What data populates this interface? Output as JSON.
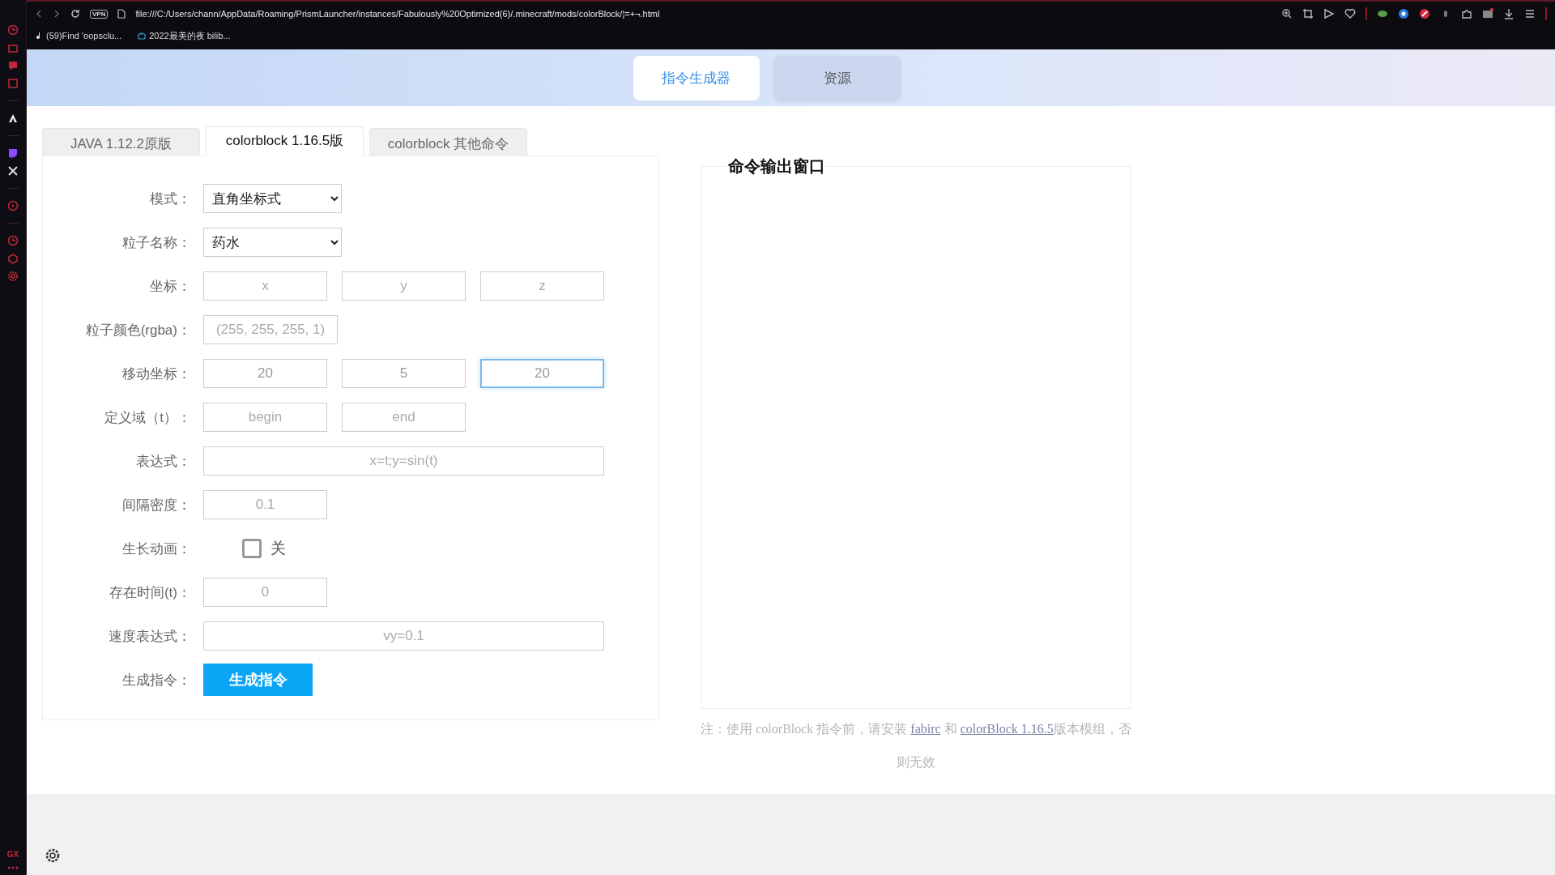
{
  "browser": {
    "url": "file:///C:/Users/chann/AppData/Roaming/PrismLauncher/instances/Fabulously%20Optimized(6)/.minecraft/mods/colorBlock/¦=+¬.html",
    "vpn_badge": "VPN",
    "bookmarks": [
      {
        "label": "(59)Find 'oopsclu..."
      },
      {
        "label": "2022最美的夜 bilib..."
      }
    ]
  },
  "sidebar": {
    "label": "GX"
  },
  "nav": [
    {
      "label": "指令生成器",
      "selected": true
    },
    {
      "label": "资源",
      "selected": false
    }
  ],
  "tabs": [
    {
      "label": "JAVA 1.12.2原版",
      "selected": false
    },
    {
      "label": "colorblock 1.16.5版",
      "selected": true
    },
    {
      "label": "colorblock 其他命令",
      "selected": false
    }
  ],
  "form": {
    "rows": [
      {
        "kind": "select",
        "label": "模式：",
        "value": "直角坐标式"
      },
      {
        "kind": "select",
        "label": "粒子名称：",
        "value": "药水"
      },
      {
        "kind": "inputs",
        "label": "坐标：",
        "fields": [
          {
            "placeholder": "x",
            "focused": false
          },
          {
            "placeholder": "y",
            "focused": false
          },
          {
            "placeholder": "z",
            "focused": false
          }
        ]
      },
      {
        "kind": "color",
        "label": "粒子颜色(rgba)：",
        "fields": [
          {
            "placeholder": "(255, 255, 255, 1)",
            "focused": false
          }
        ]
      },
      {
        "kind": "inputs",
        "label": "移动坐标：",
        "fields": [
          {
            "value": "20",
            "focused": false
          },
          {
            "value": "5",
            "focused": false
          },
          {
            "value": "20",
            "focused": true
          }
        ]
      },
      {
        "kind": "inputs",
        "label": "定义域（t）：",
        "fields": [
          {
            "placeholder": "begin",
            "focused": false
          },
          {
            "placeholder": "end",
            "focused": false
          }
        ]
      },
      {
        "kind": "wide",
        "label": "表达式：",
        "fields": [
          {
            "placeholder": "x=t;y=sin(t)",
            "focused": false
          }
        ]
      },
      {
        "kind": "inputs",
        "label": "间隔密度：",
        "fields": [
          {
            "placeholder": "0.1",
            "focused": false
          }
        ]
      },
      {
        "kind": "checkbox",
        "label": "生长动画：",
        "checked": false,
        "text": "关"
      },
      {
        "kind": "inputs",
        "label": "存在时间(t)：",
        "fields": [
          {
            "placeholder": "0",
            "focused": false
          }
        ]
      },
      {
        "kind": "wide",
        "label": "速度表达式：",
        "fields": [
          {
            "placeholder": "vy=0.1",
            "focused": false
          }
        ]
      },
      {
        "kind": "button",
        "label": "生成指令：",
        "text": "生成指令"
      }
    ]
  },
  "output": {
    "title": "命令输出窗口",
    "note": [
      {
        "kind": "text",
        "text": "注：使用 colorBlock 指令前，请安装 "
      },
      {
        "kind": "link",
        "text": "fabirc"
      },
      {
        "kind": "text",
        "text": " 和 "
      },
      {
        "kind": "link",
        "text": "colorBlock 1.16.5"
      },
      {
        "kind": "text",
        "text": "版本模组，否则无效"
      }
    ]
  }
}
